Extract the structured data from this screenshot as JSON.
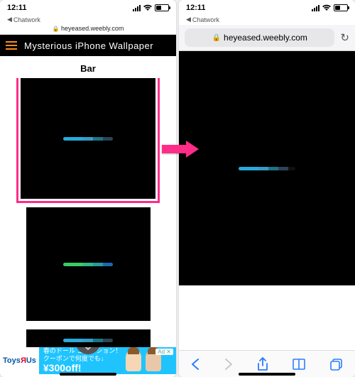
{
  "left": {
    "status": {
      "time": "12:11",
      "back_app": "Chatwork"
    },
    "url_mini": "heyeased.weebly.com",
    "site_title": "Mysterious iPhone Wallpaper",
    "section_title": "Bar",
    "wallpapers": [
      {
        "bar_colors": [
          "#2bb3e6",
          "#2bb3e6",
          "#3ba3cc",
          "#1f7a8c",
          "#2f4858"
        ],
        "selected": true
      },
      {
        "bar_colors": [
          "#3fd66a",
          "#3fd66a",
          "#35c28a",
          "#2ba3a3",
          "#216db5"
        ],
        "selected": false
      },
      {
        "bar_colors": [
          "#2bb3e6",
          "#2bb3e6",
          "#3ba3cc",
          "#1f7a8c",
          "#2f4858"
        ],
        "selected": false
      }
    ],
    "ad": {
      "logo_html": "Toys\"R\"Us",
      "line1": "春のドール コレクション！",
      "line2": "クーポンで何度でも↓",
      "price": "¥300off!",
      "badge": "Ad"
    }
  },
  "right": {
    "status": {
      "time": "12:11",
      "back_app": "Chatwork"
    },
    "url": "heyeased.weebly.com",
    "bar_colors": [
      "#2bb3e6",
      "#2bb3e6",
      "#3ba3cc",
      "#1f7a8c",
      "#2f4858"
    ]
  },
  "colors": {
    "highlight": "#ff2c88",
    "arrow": "#ff2c88",
    "hamburger": "#ff8c1a",
    "safari_blue": "#2a7dff"
  }
}
